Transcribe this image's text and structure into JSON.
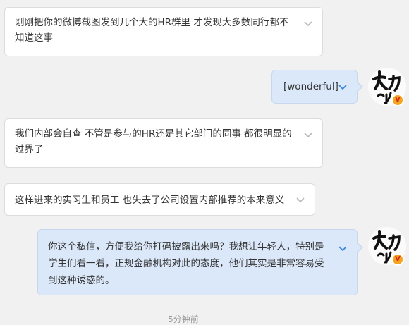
{
  "messages": [
    {
      "direction": "incoming",
      "text": "刚刚把你的微博截图发到几个大的HR群里 才发现大多数同行都不知道这事"
    },
    {
      "direction": "outgoing",
      "text": "[wonderful]"
    },
    {
      "direction": "incoming",
      "text": "我们内部会自查 不管是参与的HR还是其它部门的同事 都很明显的过界了"
    },
    {
      "direction": "incoming",
      "text": "这样进来的实习生和员工 也失去了公司设置内部推荐的本来意义"
    },
    {
      "direction": "outgoing",
      "text": "你这个私信，方便我给你打码披露出来吗？我想让年轻人，特别是学生们看一看，正规金融机构对此的态度，他们其实是非常容易受到这种诱惑的。"
    }
  ],
  "avatar": {
    "icon": "calligraphy-avatar-icon",
    "badge_text": "V",
    "badge_color": "#f4a41f"
  },
  "timestamp": "5分钟前",
  "colors": {
    "background": "#f1f1f2",
    "incoming_bubble": "#ffffff",
    "outgoing_bubble": "#dbe8fa",
    "chevron": "#3b86d8"
  }
}
